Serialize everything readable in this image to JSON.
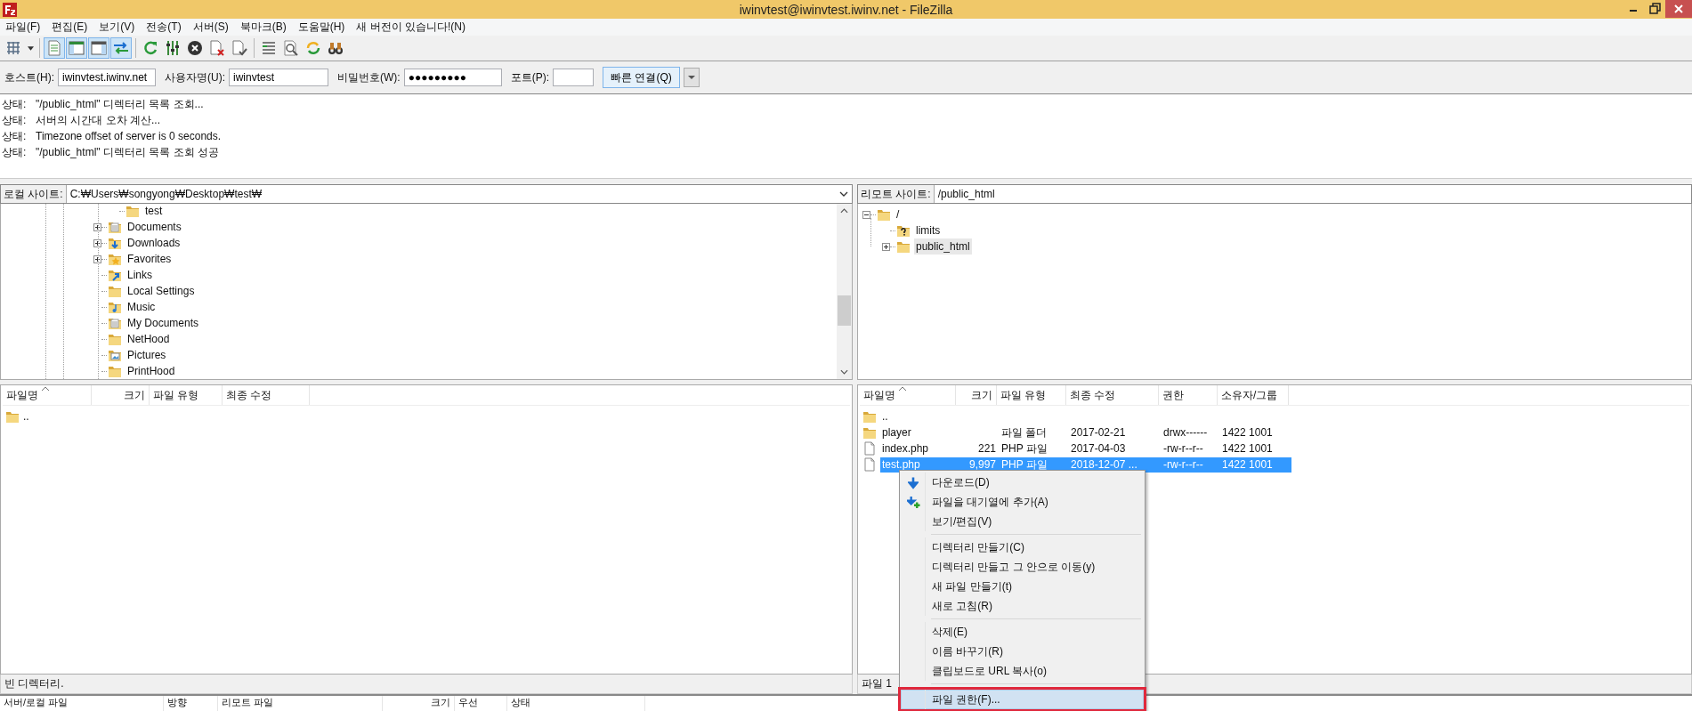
{
  "window": {
    "title": "iwinvtest@iwinvtest.iwinv.net - FileZilla"
  },
  "menu": [
    "파일(F)",
    "편집(E)",
    "보기(V)",
    "전송(T)",
    "서버(S)",
    "북마크(B)",
    "도움말(H)",
    "새 버전이 있습니다!(N)"
  ],
  "toolbar": [
    {
      "kind": "site-manager",
      "pressed": false
    },
    {
      "kind": "caret",
      "pressed": false
    },
    {
      "kind": "separator"
    },
    {
      "kind": "log",
      "pressed": true
    },
    {
      "kind": "local-tree",
      "pressed": true
    },
    {
      "kind": "remote-tree",
      "pressed": true
    },
    {
      "kind": "queue",
      "pressed": true
    },
    {
      "kind": "separator"
    },
    {
      "kind": "refresh",
      "pressed": false
    },
    {
      "kind": "process",
      "pressed": false
    },
    {
      "kind": "cancel",
      "pressed": false
    },
    {
      "kind": "disconnect",
      "pressed": false
    },
    {
      "kind": "reconnect",
      "pressed": false
    },
    {
      "kind": "separator"
    },
    {
      "kind": "filter",
      "pressed": false
    },
    {
      "kind": "compare",
      "pressed": false
    },
    {
      "kind": "sync",
      "pressed": false
    },
    {
      "kind": "find",
      "pressed": false
    }
  ],
  "quickconnect": {
    "fields": [
      {
        "label": "호스트(H):",
        "value": "iwinvtest.iwinv.net"
      },
      {
        "label": "사용자명(U):",
        "value": "iwinvtest"
      },
      {
        "label": "비밀번호(W):",
        "value": "●●●●●●●●●"
      },
      {
        "label": "포트(P):"
      }
    ],
    "button": "빠른 연결(Q)"
  },
  "log": [
    {
      "label": "상태:",
      "text": "\"/public_html\" 디렉터리 목록 조회..."
    },
    {
      "label": "상태:",
      "text": "서버의 시간대 오차 계산..."
    },
    {
      "label": "상태:",
      "text": "Timezone offset of server is 0 seconds."
    },
    {
      "label": "상태:",
      "text": "\"/public_html\" 디렉터리 목록 조회 성공"
    }
  ],
  "local": {
    "label": "로컬 사이트:",
    "path": "C:₩Users₩songyong₩Desktop₩test₩",
    "tree": [
      {
        "children": [
          {
            "label": "test",
            "kind": "folder"
          }
        ]
      },
      {
        "label": "Documents",
        "kind": "documents",
        "expanded": false
      },
      {
        "label": "Downloads",
        "kind": "downloads",
        "expanded": false
      },
      {
        "label": "Favorites",
        "kind": "favorites",
        "expanded": false
      },
      {
        "label": "Links",
        "kind": "links"
      },
      {
        "label": "Local Settings",
        "kind": "folder"
      },
      {
        "label": "Music",
        "kind": "music"
      },
      {
        "label": "My Documents",
        "kind": "documents"
      },
      {
        "label": "NetHood",
        "kind": "folder"
      },
      {
        "label": "Pictures",
        "kind": "pictures"
      },
      {
        "label": "PrintHood",
        "kind": "folder"
      }
    ],
    "columns": [
      {
        "label": "파일명",
        "sorted": true
      },
      {
        "label": "크기",
        "sorted": false
      },
      {
        "label": "파일 유형",
        "sorted": false
      },
      {
        "label": "최종 수정",
        "sorted": false
      }
    ],
    "rows": [
      {
        "name": "..",
        "kind": "folder"
      }
    ],
    "status": "빈 디렉터리."
  },
  "remote": {
    "label": "리모트 사이트:",
    "path": "/public_html",
    "tree": [
      {
        "label": "/",
        "kind": "folder",
        "expanded": true,
        "selected": false,
        "children": [
          {
            "label": "limits",
            "kind": "unknown",
            "selected": false
          },
          {
            "label": "public_html",
            "kind": "folder",
            "expanded": false,
            "selected": true
          }
        ]
      }
    ],
    "columns": [
      {
        "label": "파일명",
        "sorted": true
      },
      {
        "label": "크기",
        "sorted": false
      },
      {
        "label": "파일 유형",
        "sorted": false
      },
      {
        "label": "최종 수정",
        "sorted": false
      },
      {
        "label": "권한",
        "sorted": false
      },
      {
        "label": "소유자/그룹",
        "sorted": false
      }
    ],
    "rows": [
      {
        "name": "..",
        "kind": "folder",
        "selected": false
      },
      {
        "name": "player",
        "type": "파일 폴더",
        "modified": "2017-02-21",
        "permissions": "drwx------",
        "owner": "1422 1001",
        "kind": "folder",
        "selected": false
      },
      {
        "name": "index.php",
        "size": "221",
        "type": "PHP 파일",
        "modified": "2017-04-03",
        "permissions": "-rw-r--r--",
        "owner": "1422 1001",
        "kind": "file",
        "selected": false
      },
      {
        "name": "test.php",
        "size": "9,997",
        "type": "PHP 파일",
        "modified": "2018-12-07 ...",
        "permissions": "-rw-r--r--",
        "owner": "1422 1001",
        "kind": "file",
        "selected": true
      }
    ],
    "status": "파일 1"
  },
  "context_menu": [
    [
      {
        "label": "다운로드(D)",
        "kind": "download",
        "selected": false
      },
      {
        "label": "파일을 대기열에 추가(A)",
        "kind": "queue",
        "selected": false
      },
      {
        "label": "보기/편집(V)",
        "kind": "plain",
        "selected": false
      }
    ],
    [
      {
        "label": "디렉터리 만들기(C)",
        "kind": "plain",
        "selected": false
      },
      {
        "label": "디렉터리 만들고 그 안으로 이동(y)",
        "kind": "plain",
        "selected": false
      },
      {
        "label": "새 파일 만들기(t)",
        "kind": "plain",
        "selected": false
      },
      {
        "label": "새로 고침(R)",
        "kind": "plain",
        "selected": false
      }
    ],
    [
      {
        "label": "삭제(E)",
        "kind": "plain",
        "selected": false
      },
      {
        "label": "이름 바꾸기(R)",
        "kind": "plain",
        "selected": false
      },
      {
        "label": "클립보드로 URL 복사(o)",
        "kind": "plain",
        "selected": false
      }
    ],
    [
      {
        "label": "파일 권한(F)...",
        "kind": "plain",
        "selected": true
      }
    ]
  ],
  "queue": {
    "columns": [
      "서버/로컬 파일",
      "방향",
      "리모트 파일",
      "크기",
      "우선",
      "상태"
    ]
  }
}
